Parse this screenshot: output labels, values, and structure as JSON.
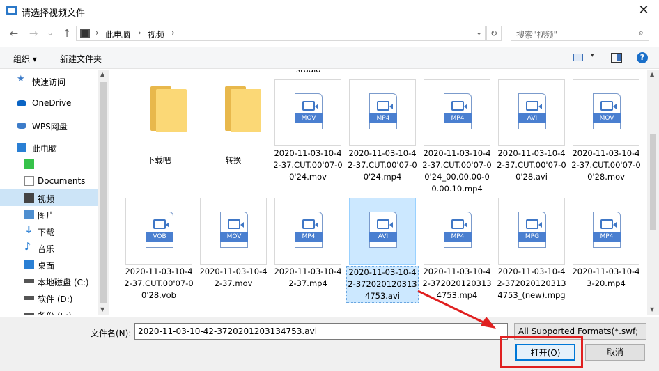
{
  "window": {
    "title": "请选择视频文件",
    "close_glyph": "✕"
  },
  "nav": {
    "back": "←",
    "forward": "→",
    "recent": "⌄",
    "up": "↑"
  },
  "address": {
    "crumbs": [
      "此电脑",
      "视频"
    ],
    "sep": "›",
    "dropdown": "⌄",
    "refresh": "↻"
  },
  "search": {
    "placeholder": "搜索\"视频\"",
    "icon": "⌕"
  },
  "toolbar": {
    "organize": "组织 ▾",
    "new_folder": "新建文件夹",
    "dropdown": "▾",
    "help": "?"
  },
  "sidebar": {
    "items": [
      {
        "label": "快速访问",
        "icon": "star-icon",
        "color": "#3d7cc9"
      },
      {
        "label": "OneDrive",
        "icon": "cloud-icon",
        "color": "#0a64c4"
      },
      {
        "label": "WPS网盘",
        "icon": "cloud-icon",
        "color": "#3d7cc9"
      },
      {
        "label": "此电脑",
        "icon": "computer-icon",
        "color": "#2a7fd4"
      },
      {
        "label": "",
        "icon": "app-icon",
        "color": "#36c24a"
      },
      {
        "label": "Documents",
        "icon": "document-icon",
        "color": "#888888"
      },
      {
        "label": "视频",
        "icon": "video-icon",
        "color": "#444444"
      },
      {
        "label": "图片",
        "icon": "picture-icon",
        "color": "#4f8fd0"
      },
      {
        "label": "下载",
        "icon": "download-icon",
        "color": "#2a7fd4"
      },
      {
        "label": "音乐",
        "icon": "music-icon",
        "color": "#2a7fd4"
      },
      {
        "label": "桌面",
        "icon": "desktop-icon",
        "color": "#2a7fd4"
      },
      {
        "label": "本地磁盘 (C:)",
        "icon": "drive-icon",
        "color": "#555555"
      },
      {
        "label": "软件 (D:)",
        "icon": "drive-icon",
        "color": "#555555"
      },
      {
        "label": "备份 (E:)",
        "icon": "drive-icon",
        "color": "#555555"
      }
    ],
    "selected_index": 6
  },
  "files": {
    "partial_label": "studio",
    "row1": [
      {
        "type": "folder",
        "name": "下载吧"
      },
      {
        "type": "folder",
        "name": "转换"
      },
      {
        "type": "video",
        "ext": "MOV",
        "name": "2020-11-03-10-42-37.CUT.00'07-00'24.mov"
      },
      {
        "type": "video",
        "ext": "MP4",
        "name": "2020-11-03-10-42-37.CUT.00'07-00'24.mp4"
      },
      {
        "type": "video",
        "ext": "MP4",
        "name": "2020-11-03-10-42-37.CUT.00'07-00'24_00.00.00-00.00.10.mp4"
      },
      {
        "type": "video",
        "ext": "AVI",
        "name": "2020-11-03-10-42-37.CUT.00'07-00'28.avi"
      },
      {
        "type": "video",
        "ext": "MOV",
        "name": "2020-11-03-10-42-37.CUT.00'07-00'28.mov"
      }
    ],
    "row2": [
      {
        "type": "video",
        "ext": "VOB",
        "name": "2020-11-03-10-42-37.CUT.00'07-00'28.vob"
      },
      {
        "type": "video",
        "ext": "MOV",
        "name": "2020-11-03-10-42-37.mov"
      },
      {
        "type": "video",
        "ext": "MP4",
        "name": "2020-11-03-10-42-37.mp4"
      },
      {
        "type": "video",
        "ext": "AVI",
        "name": "2020-11-03-10-42-3720201203134753.avi",
        "selected": true
      },
      {
        "type": "video",
        "ext": "MP4",
        "name": "2020-11-03-10-42-3720201203134753.mp4"
      },
      {
        "type": "video",
        "ext": "MPG",
        "name": "2020-11-03-10-42-3720201203134753_(new).mpg"
      },
      {
        "type": "video",
        "ext": "MP4",
        "name": "2020-11-03-10-43-20.mp4"
      }
    ]
  },
  "footer": {
    "filename_label": "文件名(N):",
    "filename_value": "2020-11-03-10-42-3720201203134753.avi",
    "filter_value": "All Supported Formats(*.swf;",
    "open_label": "打开(O)",
    "cancel_label": "取消",
    "dropdown": "⌄"
  },
  "colors": {
    "accent": "#0078d7",
    "annotation": "#e02020",
    "selection": "#cce8ff"
  }
}
